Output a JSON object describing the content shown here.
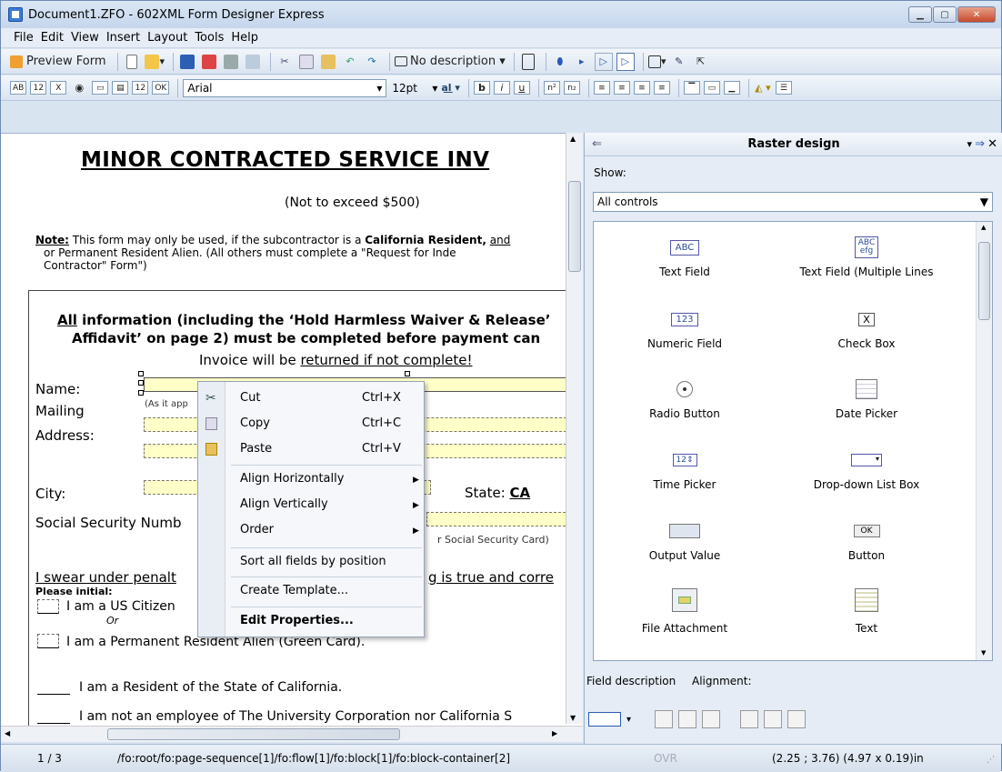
{
  "window": {
    "title": "Document1.ZFO - 602XML Form Designer Express"
  },
  "menu": [
    "File",
    "Edit",
    "View",
    "Insert",
    "Layout",
    "Tools",
    "Help"
  ],
  "toolbar1": {
    "preview_label": "Preview Form",
    "description_dropdown": "No description"
  },
  "toolbar2": {
    "field_icons": [
      "AB",
      "12",
      "X",
      "◉",
      "▭",
      "▤",
      "12",
      "OK"
    ],
    "font": "Arial",
    "size": "12pt"
  },
  "document": {
    "heading": "MINOR CONTRACTED SERVICE INV",
    "subheading": "(Not to exceed $500)",
    "note_label": "Note:",
    "note_text_1": "This form may only be used, if the subcontractor is a",
    "note_bold": "California Resident,",
    "note_underlined": "and",
    "note_text_2": "or Permanent Resident Alien. (All others must complete a \"Request for Inde",
    "note_text_3": "Contractor\" Form\")",
    "info_line_1_pre": "All",
    "info_line_1": " information (including the ‘Hold Harmless Waiver & Release’",
    "info_line_2": "Affidavit’ on page 2) must be completed before payment can",
    "returned_pre": "Invoice will be ",
    "returned_link": "returned if not complete!",
    "name_label": "Name:",
    "as_it_appears": "(As it app",
    "mailing_label": "Mailing",
    "address_label": "Address:",
    "city_label": "City:",
    "state_label": "State:",
    "state_value": "CA",
    "ssn_label": "Social Security Numb",
    "ssn_hint": "r Social Security Card)",
    "swear_text": "I swear under penalt",
    "swear_text_end": "g is true and corre",
    "please_initial": "Please initial:",
    "citizen": "I am a US Citizen",
    "or": "Or",
    "perm_res": "I am a Permanent Resident Alien (Green Card).",
    "resident": "I am a Resident of the State of California.",
    "not_employee": "I am not an employee of The University Corporation nor California S"
  },
  "context_menu": {
    "items": [
      {
        "label": "Cut",
        "shortcut": "Ctrl+X"
      },
      {
        "label": "Copy",
        "shortcut": "Ctrl+C"
      },
      {
        "label": "Paste",
        "shortcut": "Ctrl+V"
      },
      {
        "label": "Align Horizontally"
      },
      {
        "label": "Align Vertically"
      },
      {
        "label": "Order"
      },
      {
        "label": "Sort all fields by position"
      },
      {
        "label": "Create Template..."
      },
      {
        "label": "Edit Properties..."
      }
    ]
  },
  "panel": {
    "title": "Raster design",
    "show_label": "Show:",
    "show_value": "All controls",
    "controls": [
      "Text Field",
      "Text Field (Multiple Lines",
      "Numeric Field",
      "Check Box",
      "Radio Button",
      "Date Picker",
      "Time Picker",
      "Drop-down List Box",
      "Output Value",
      "Button",
      "File Attachment",
      "Text"
    ],
    "field_description": "Field description",
    "alignment": "Alignment:"
  },
  "status": {
    "page": "1 / 3",
    "path": "/fo:root/fo:page-sequence[1]/fo:flow[1]/fo:block[1]/fo:block-container[2]",
    "ovr": "OVR",
    "coords": "(2.25 ; 3.76) (4.97 x 0.19)in"
  }
}
